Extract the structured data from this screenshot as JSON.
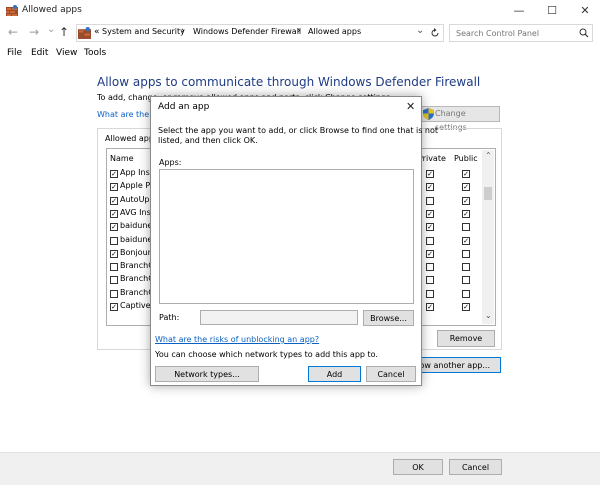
{
  "window": {
    "title": "Allowed apps",
    "minimize": "—",
    "maximize": "☐",
    "close": "✕"
  },
  "nav": {
    "back": "←",
    "forward": "→",
    "dropdown": "⌄",
    "up": "↑",
    "overflow": "«",
    "breadcrumb": [
      "System and Security",
      "Windows Defender Firewall",
      "Allowed apps"
    ],
    "separator": "›",
    "search_placeholder": "Search Control Panel"
  },
  "menu": [
    "File",
    "Edit",
    "View",
    "Tools"
  ],
  "main": {
    "heading": "Allow apps to communicate through Windows Defender Firewall",
    "description": "To add, change, or remove allowed apps and ports, click Change settings.",
    "link": "What are the risks of allowing an app to communicate?",
    "change_settings": "Change settings",
    "allowed_label": "Allowed apps and features:",
    "columns": {
      "name": "Name",
      "private": "Private",
      "public": "Public"
    },
    "rows": [
      {
        "name": "App Installer",
        "checked": true,
        "private": true,
        "public": true
      },
      {
        "name": "Apple Push",
        "checked": true,
        "private": true,
        "public": true
      },
      {
        "name": "AutoUpdate",
        "checked": true,
        "private": false,
        "public": true
      },
      {
        "name": "AVG Installer",
        "checked": true,
        "private": true,
        "public": true
      },
      {
        "name": "baidunetdisk",
        "checked": true,
        "private": true,
        "public": false
      },
      {
        "name": "baidunetdisk",
        "checked": false,
        "private": false,
        "public": true
      },
      {
        "name": "Bonjour",
        "checked": true,
        "private": true,
        "public": false
      },
      {
        "name": "BranchCache",
        "checked": false,
        "private": false,
        "public": false
      },
      {
        "name": "BranchCache",
        "checked": false,
        "private": false,
        "public": false
      },
      {
        "name": "BranchCache",
        "checked": false,
        "private": false,
        "public": false
      },
      {
        "name": "Captive Portal",
        "checked": true,
        "private": true,
        "public": true
      }
    ],
    "remove": "Remove",
    "allow_another": "Allow another app..."
  },
  "dialog": {
    "title": "Add an app",
    "close": "✕",
    "instructions_line1": "Select the app you want to add, or click Browse to find one that is not",
    "instructions_line2": "listed, and then click OK.",
    "apps_label": "Apps:",
    "path_label": "Path:",
    "browse": "Browse...",
    "risks_link": "What are the risks of unblocking an app?",
    "network_note": "You can choose which network types to add this app to.",
    "network_types": "Network types...",
    "add": "Add",
    "cancel": "Cancel"
  },
  "footer": {
    "ok": "OK",
    "cancel": "Cancel"
  },
  "scroll": {
    "up": "⌃",
    "down": "⌄"
  },
  "colors": {
    "heading": "#1e3c84",
    "link": "#0b61c2",
    "accent": "#0078d7"
  },
  "icons": {
    "app": "firewall-bricks-icon",
    "shield": "shield-icon",
    "refresh": "refresh-icon",
    "search": "search-icon"
  }
}
